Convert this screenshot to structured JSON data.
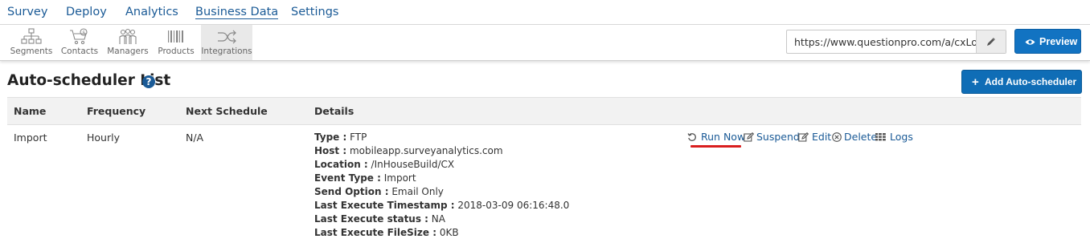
{
  "topnav": {
    "items": [
      {
        "label": "Survey"
      },
      {
        "label": "Deploy"
      },
      {
        "label": "Analytics"
      },
      {
        "label": "Business Data"
      },
      {
        "label": "Settings"
      }
    ]
  },
  "subnav": {
    "tools": [
      {
        "label": "Segments",
        "icon": "segments-icon"
      },
      {
        "label": "Contacts",
        "icon": "contacts-icon"
      },
      {
        "label": "Managers",
        "icon": "managers-icon"
      },
      {
        "label": "Products",
        "icon": "products-icon"
      },
      {
        "label": "Integrations",
        "icon": "integrations-icon"
      }
    ]
  },
  "url_field": {
    "value": "https://www.questionpro.com/a/cxLogin."
  },
  "preview_button": {
    "label": "Preview"
  },
  "page": {
    "title": "Auto-scheduler List",
    "add_button": "Add Auto-scheduler"
  },
  "table": {
    "columns": [
      "Name",
      "Frequency",
      "Next Schedule",
      "Details"
    ],
    "row": {
      "name": "Import",
      "frequency": "Hourly",
      "next_schedule": "N/A",
      "details": [
        {
          "key": "Type :",
          "value": " FTP"
        },
        {
          "key": "Host :",
          "value": " mobileapp.surveyanalytics.com"
        },
        {
          "key": "Location :",
          "value": " /InHouseBuild/CX"
        },
        {
          "key": "Event Type :",
          "value": " Import"
        },
        {
          "key": "Send Option :",
          "value": " Email Only"
        },
        {
          "key": "Last Execute Timestamp :",
          "value": " 2018-03-09 06:16:48.0"
        },
        {
          "key": "Last Execute status :",
          "value": " NA"
        },
        {
          "key": "Last Execute FileSize :",
          "value": " 0KB"
        }
      ],
      "actions": [
        {
          "label": "Run Now",
          "icon": "refresh-icon"
        },
        {
          "label": "Suspend",
          "icon": "edit-square-icon"
        },
        {
          "label": "Edit",
          "icon": "edit-square-icon"
        },
        {
          "label": "Delete",
          "icon": "close-circle-icon"
        },
        {
          "label": "Logs",
          "icon": "list-icon"
        }
      ]
    }
  },
  "colors": {
    "link": "#1a5a96",
    "primary_button": "#1273c2",
    "highlight_underline": "#d91e1e"
  }
}
